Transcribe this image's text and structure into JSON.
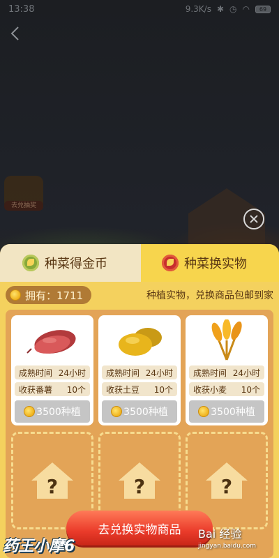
{
  "status_bar": {
    "time": "13:38",
    "network_speed": "9.3K/s",
    "battery": "69"
  },
  "background": {
    "badge_label": "去兑抽奖"
  },
  "tabs": [
    {
      "label": "种菜得金币",
      "icon": "coin-plant-icon"
    },
    {
      "label": "种菜换实物",
      "icon": "leaf-icon",
      "selected": true
    }
  ],
  "own": {
    "label": "拥有：1711",
    "note": "种植实物，兑换商品包邮到家"
  },
  "cards": [
    {
      "name": "sweet-potato",
      "time_label": "成熟时间",
      "time_value": "24小时",
      "harvest_label": "收获番薯",
      "harvest_count": "10个",
      "price": "3500种植"
    },
    {
      "name": "potato",
      "time_label": "成熟时间",
      "time_value": "24小时",
      "harvest_label": "收获土豆",
      "harvest_count": "10个",
      "price": "3500种植"
    },
    {
      "name": "wheat",
      "time_label": "成熟时间",
      "time_value": "24小时",
      "harvest_label": "收获小麦",
      "harvest_count": "10个",
      "price": "3500种植"
    }
  ],
  "exchange_button": "去兑换实物商品",
  "watermark": {
    "left": "药王小摩6",
    "right": "Bai 经验",
    "right_sub": "jingyan.baidu.com"
  },
  "colors": {
    "panel": "#f4d15e",
    "grid": "#e3a457",
    "button": "#ea3b2a"
  }
}
